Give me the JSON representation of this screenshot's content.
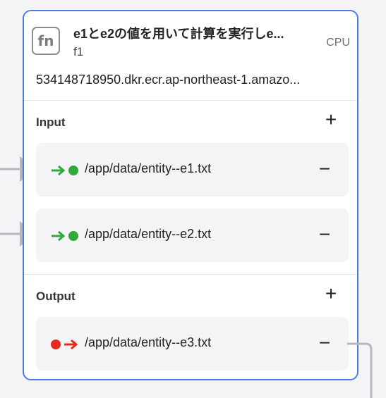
{
  "node": {
    "icon_label": "fn",
    "title": "e1とe2の値を用いて計算を実行しe...",
    "name": "f1",
    "resource": "CPU",
    "image_uri": "534148718950.dkr.ecr.ap-northeast-1.amazo..."
  },
  "input": {
    "title": "Input",
    "add_label": "+",
    "items": [
      {
        "path": "/app/data/entity--e1.txt",
        "remove_label": "−"
      },
      {
        "path": "/app/data/entity--e2.txt",
        "remove_label": "−"
      }
    ]
  },
  "output": {
    "title": "Output",
    "add_label": "+",
    "items": [
      {
        "path": "/app/data/entity--e3.txt",
        "remove_label": "−"
      }
    ]
  },
  "colors": {
    "border_accent": "#4a7ee6",
    "input_arrow": "#2eaa3a",
    "input_dot": "#2eaa3a",
    "output_arrow": "#e52a1d",
    "output_dot": "#e52a1d",
    "connector": "#b7b7bd"
  }
}
